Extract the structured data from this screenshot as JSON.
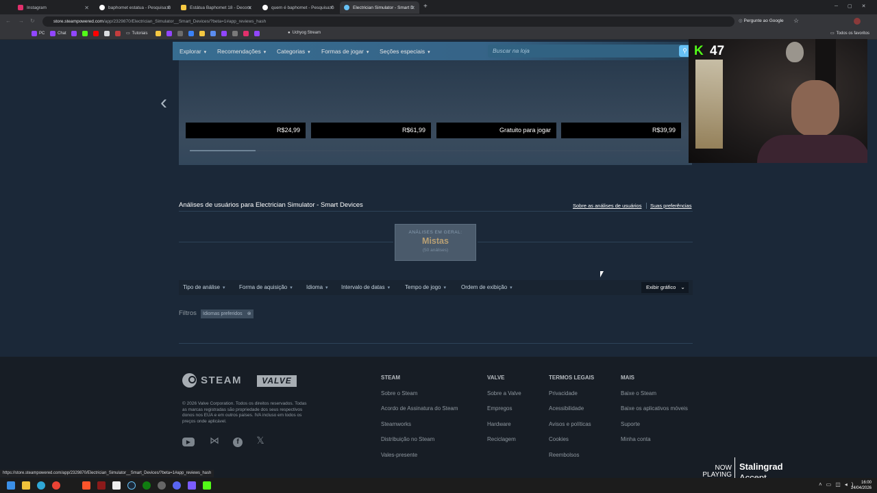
{
  "browser": {
    "tabs": [
      {
        "title": "Instagram",
        "favcolor": "#e1306c"
      },
      {
        "title": "baphomet estatua - Pesquisa G",
        "favcolor": "#ffffff"
      },
      {
        "title": "Estátua Baphomet 18 - Decora",
        "favcolor": "#f5c842"
      },
      {
        "title": "quem é baphomet - Pesquisa G",
        "favcolor": "#ffffff"
      },
      {
        "title": "Electrician Simulator - Smart D",
        "favcolor": "#1b2838"
      }
    ],
    "url_host": "store.steampowered.com",
    "url_path": "/app/2329870/Electrician_Simulator__Smart_Devices/?beta=1#app_reviews_hash",
    "ask_google": "Pergunte ao Google",
    "all_bookmarks": "Todos os favoritos",
    "bookmarks": [
      "PC",
      "Chat",
      "Tutoriais",
      "Uchyog Stream"
    ],
    "status_url": "https://store.steampowered.com/app/2329870/Electrician_Simulator__Smart_Devices/?beta=1#app_reviews_hash"
  },
  "steam_nav": {
    "items": [
      "Explorar",
      "Recomendações",
      "Categorias",
      "Formas de jogar",
      "Seções especiais"
    ],
    "search_placeholder": "Buscar na loja"
  },
  "carousel": {
    "prices": [
      "R$24,99",
      "R$61,99",
      "Gratuito para jogar",
      "R$39,99"
    ]
  },
  "stream_overlay": {
    "viewer_count": "47",
    "now_label": "NOW",
    "playing_label": "PLAYING",
    "track": "Stalingrad",
    "artist": "Accept"
  },
  "reviews": {
    "title": "Análises de usuários para Electrician Simulator - Smart Devices",
    "link_about": "Sobre as análises de usuários",
    "link_prefs": "Suas preferências",
    "overall_label": "ANÁLISES EM GERAL:",
    "overall_value": "Mistas",
    "overall_count": "(50 análises)",
    "filters": [
      "Tipo de análise",
      "Forma de aquisição",
      "Idioma",
      "Intervalo de datas",
      "Tempo de jogo",
      "Ordem de exibição"
    ],
    "show_graph": "Exibir gráfico",
    "filters_label": "Filtros",
    "chip": "Idiomas preferidos"
  },
  "footer": {
    "steam_word": "STEAM",
    "valve_word": "VALVE",
    "legal": "© 2026 Valve Corporation. Todos os direitos reservados. Todas as marcas registradas são propriedade dos seus respectivos donos nos EUA e em outros países. IVA incluso em todos os preços onde aplicável.",
    "columns": [
      {
        "head": "STEAM",
        "links": [
          "Sobre o Steam",
          "Acordo de Assinatura do Steam",
          "Steamworks",
          "Distribuição no Steam",
          "Vales-presente"
        ]
      },
      {
        "head": "VALVE",
        "links": [
          "Sobre a Valve",
          "Empregos",
          "Hardware",
          "Reciclagem"
        ]
      },
      {
        "head": "TERMOS LEGAIS",
        "links": [
          "Privacidade",
          "Acessibilidade",
          "Avisos e políticas",
          "Cookies",
          "Reembolsos"
        ]
      },
      {
        "head": "MAIS",
        "links": [
          "Baixe o Steam",
          "Baixe os aplicativos móveis",
          "Suporte",
          "Minha conta"
        ]
      }
    ]
  },
  "taskbar": {
    "time": "16:00",
    "date": "24/04/2026"
  }
}
